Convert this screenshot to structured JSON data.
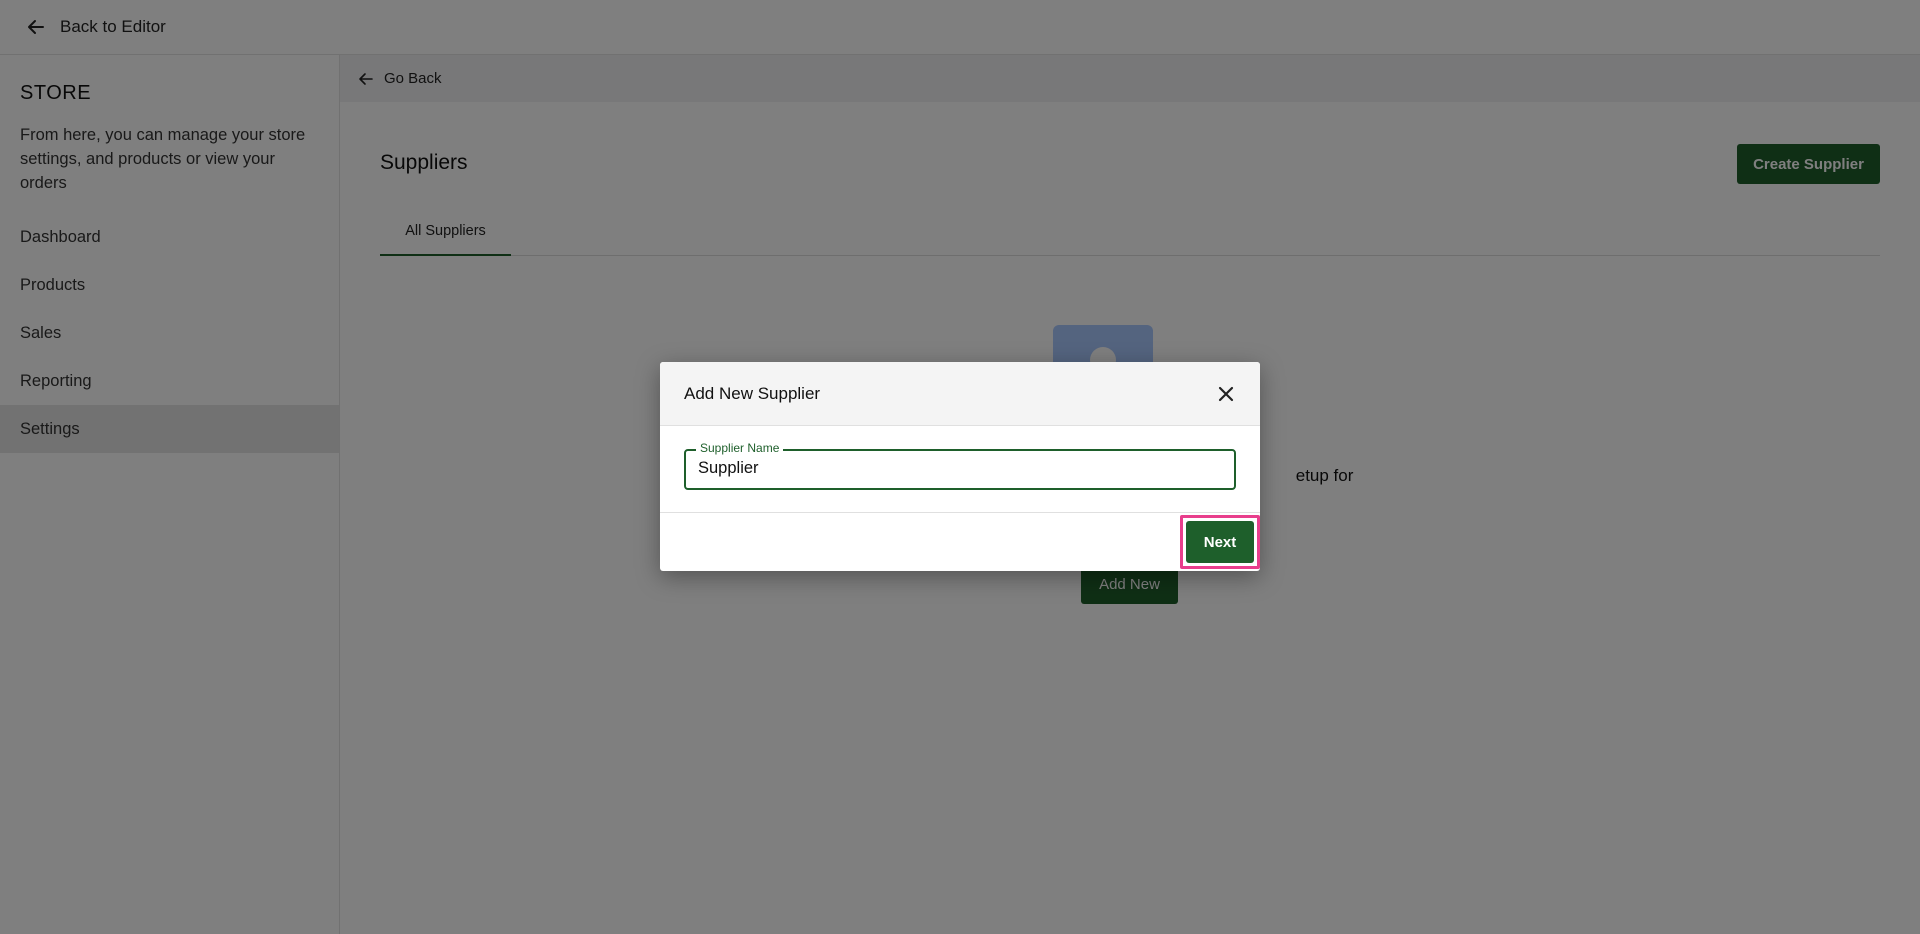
{
  "topbar": {
    "back_label": "Back to Editor",
    "back_icon": "arrow-left-icon"
  },
  "sidebar": {
    "title": "STORE",
    "description": "From here, you can manage your store settings, and products or view your orders",
    "items": [
      {
        "label": "Dashboard",
        "active": false
      },
      {
        "label": "Products",
        "active": false
      },
      {
        "label": "Sales",
        "active": false
      },
      {
        "label": "Reporting",
        "active": false
      },
      {
        "label": "Settings",
        "active": true
      }
    ]
  },
  "main": {
    "go_back_label": "Go Back",
    "title": "Suppliers",
    "create_label": "Create Supplier",
    "tabs": [
      {
        "label": "All Suppliers",
        "active": true
      }
    ],
    "empty_state": {
      "text_visible": "etup for",
      "button_label": "Add New",
      "icon": "supplier-placeholder-icon"
    }
  },
  "modal": {
    "title": "Add New Supplier",
    "field_label": "Supplier Name",
    "field_value": "Supplier",
    "next_label": "Next"
  },
  "colors": {
    "brand": "#1e5f2b",
    "highlight": "#e83e8c",
    "empty_icon": "#a9c8ff"
  }
}
